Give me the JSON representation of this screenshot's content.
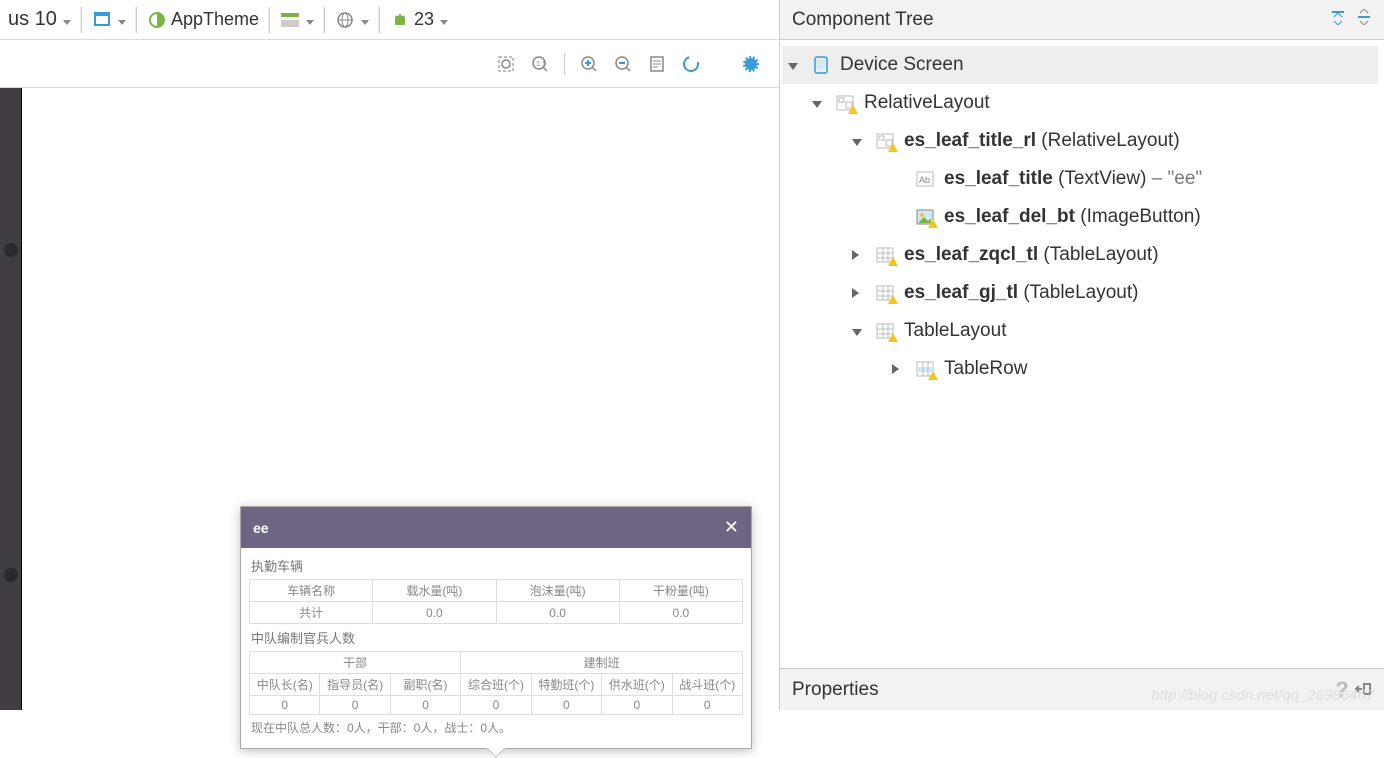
{
  "toolbar1": {
    "device": "us 10",
    "theme_label": "AppTheme",
    "api_label": "23"
  },
  "popup": {
    "title": "ee",
    "sec1": "执勤车辆",
    "row1_headers": [
      "车辆名称",
      "载水量(吨)",
      "泡沫量(吨)",
      "干粉量(吨)"
    ],
    "row1_total_label": "共计",
    "row1_values": [
      "0.0",
      "0.0",
      "0.0"
    ],
    "sec2": "中队编制官兵人数",
    "group_left": "干部",
    "group_right": "建制班",
    "cols": [
      "中队长(名)",
      "指导员(名)",
      "副职(名)",
      "综合班(个)",
      "特勤班(个)",
      "供水班(个)",
      "战斗班(个)"
    ],
    "vals": [
      "0",
      "0",
      "0",
      "0",
      "0",
      "0",
      "0"
    ],
    "summary": "现在中队总人数：0人，干部：0人，战士：0人。"
  },
  "tree_title": "Component Tree",
  "tree": {
    "root": "Device Screen",
    "n1": "RelativeLayout",
    "n2a": "es_leaf_title_rl",
    "n2a_t": " (RelativeLayout)",
    "n3a": "es_leaf_title",
    "n3a_t": " (TextView) ",
    "n3a_v": "– \"ee\"",
    "n3b": "es_leaf_del_bt",
    "n3b_t": " (ImageButton)",
    "n2b": "es_leaf_zqcl_tl",
    "n2b_t": " (TableLayout)",
    "n2c": "es_leaf_gj_tl",
    "n2c_t": " (TableLayout)",
    "n2d": "TableLayout",
    "n3d": "TableRow"
  },
  "props_title": "Properties",
  "watermark": "http://blog.csdn.net/qq_26986467"
}
